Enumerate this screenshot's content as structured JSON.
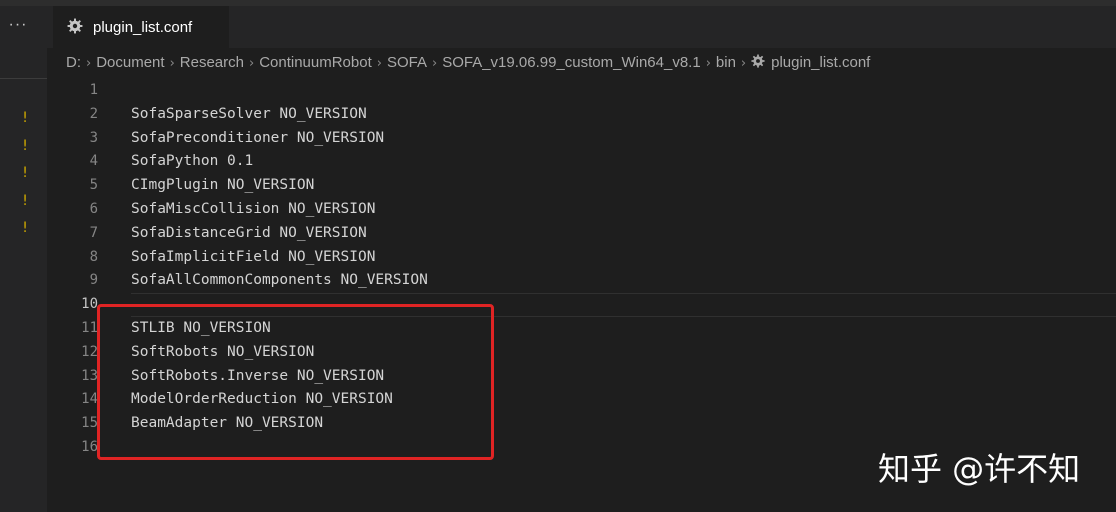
{
  "sidebar": {
    "more_label": "···",
    "warning_glyph": "!"
  },
  "tab": {
    "label": "plugin_list.conf",
    "icon": "gear-icon"
  },
  "breadcrumb": [
    "D:",
    "Document",
    "Research",
    "ContinuumRobot",
    "SOFA",
    "SOFA_v19.06.99_custom_Win64_v8.1",
    "bin",
    "plugin_list.conf"
  ],
  "breadcrumb_sep": "›",
  "editor": {
    "active_line": 10,
    "lines": [
      {
        "num": "1",
        "text": ""
      },
      {
        "num": "2",
        "text": "SofaSparseSolver NO_VERSION"
      },
      {
        "num": "3",
        "text": "SofaPreconditioner NO_VERSION"
      },
      {
        "num": "4",
        "text": "SofaPython 0.1"
      },
      {
        "num": "5",
        "text": "CImgPlugin NO_VERSION"
      },
      {
        "num": "6",
        "text": "SofaMiscCollision NO_VERSION"
      },
      {
        "num": "7",
        "text": "SofaDistanceGrid NO_VERSION"
      },
      {
        "num": "8",
        "text": "SofaImplicitField NO_VERSION"
      },
      {
        "num": "9",
        "text": "SofaAllCommonComponents NO_VERSION"
      },
      {
        "num": "10",
        "text": ""
      },
      {
        "num": "11",
        "text": "STLIB NO_VERSION"
      },
      {
        "num": "12",
        "text": "SoftRobots NO_VERSION"
      },
      {
        "num": "13",
        "text": "SoftRobots.Inverse NO_VERSION"
      },
      {
        "num": "14",
        "text": "ModelOrderReduction NO_VERSION"
      },
      {
        "num": "15",
        "text": "BeamAdapter NO_VERSION"
      },
      {
        "num": "16",
        "text": ""
      }
    ]
  },
  "highlight_color": "#e02424",
  "watermark": "知乎 @许不知"
}
